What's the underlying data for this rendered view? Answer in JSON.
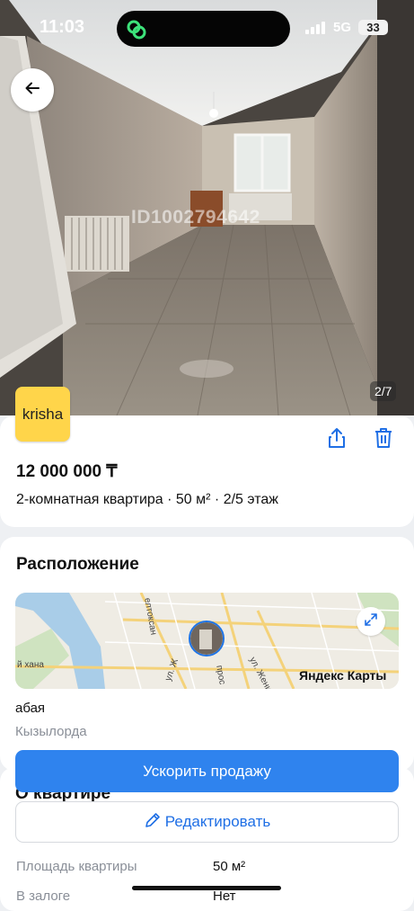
{
  "status_bar": {
    "time": "11:03",
    "network": "5G",
    "battery": "33"
  },
  "photo": {
    "watermark": "ID1002794642",
    "counter": "2/7"
  },
  "brand": {
    "logo_text": "krisha"
  },
  "listing": {
    "price": "12 000 000 ₸",
    "summary": "2-комнатная квартира · 50 м² · 2/5 этаж"
  },
  "location": {
    "title": "Расположение",
    "street": "абая",
    "city": "Кызылорда",
    "map": {
      "brand": "Яндекс Карты",
      "labels": [
        "елтоксан",
        "ул. Женис",
        "й хана",
        "ул. Ж",
        "прос"
      ]
    }
  },
  "actions": {
    "boost_label": "Ускорить продажу",
    "edit_label": "Редактировать"
  },
  "about": {
    "title": "О квартире",
    "rows": [
      {
        "label": "Площадь квартиры",
        "value": "50 м²"
      },
      {
        "label": "В залоге",
        "value": "Нет"
      }
    ]
  },
  "colors": {
    "accent": "#2f83ee",
    "logo_bg": "#ffd54a",
    "link": "#1f6fe5"
  },
  "icons": [
    "back-arrow-icon",
    "share-icon",
    "trash-icon",
    "expand-icon",
    "pencil-icon",
    "signal-icon",
    "island-link-icon"
  ]
}
